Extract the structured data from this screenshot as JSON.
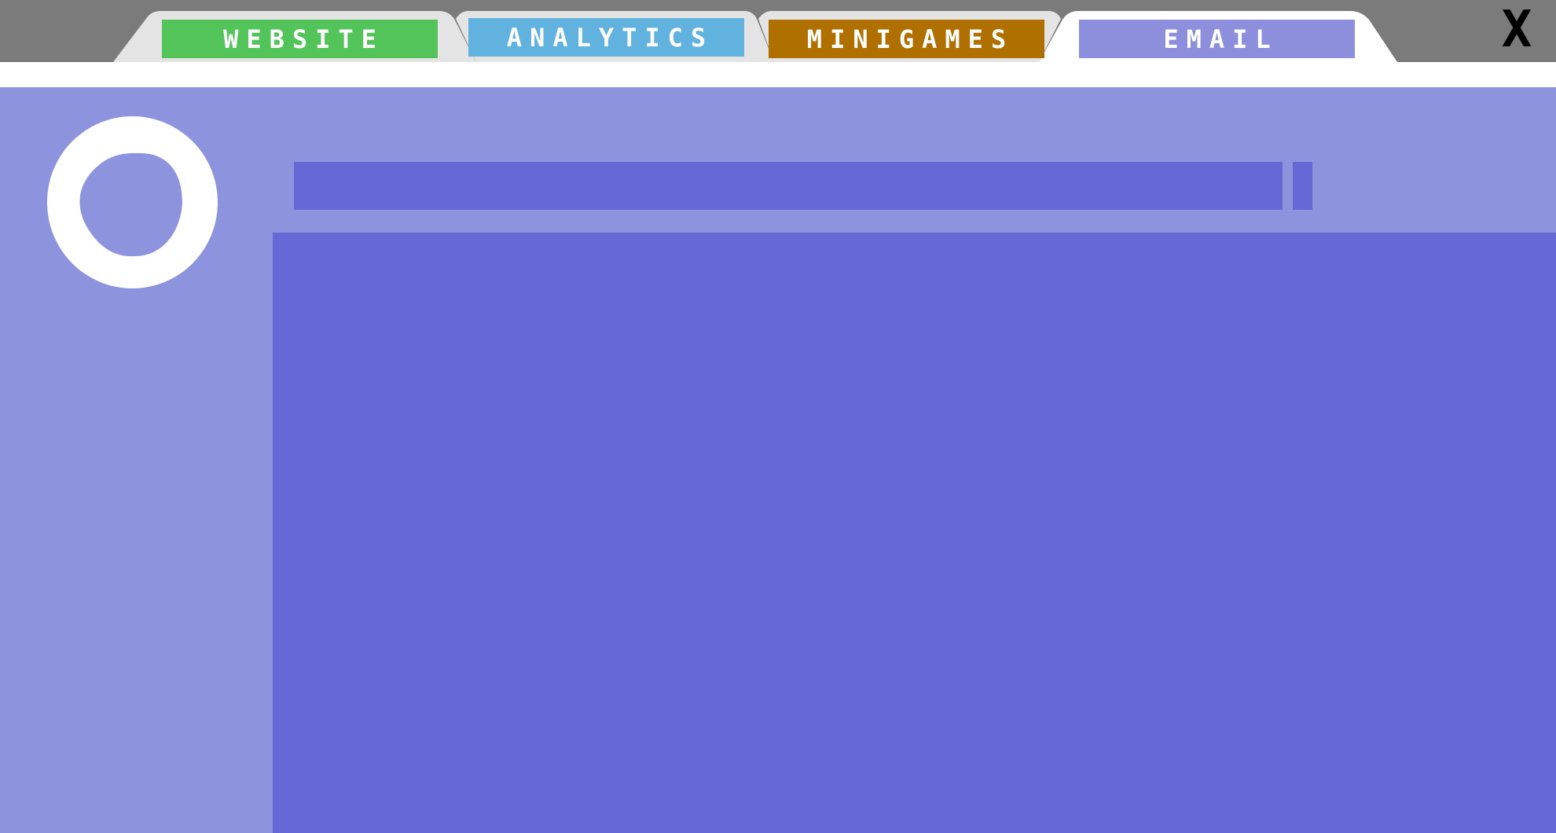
{
  "window": {
    "close_label": "X"
  },
  "tabs": [
    {
      "label": "WEBSITE",
      "color": "#52c45a",
      "active": false
    },
    {
      "label": "ANALYTICS",
      "color": "#62b2df",
      "active": false
    },
    {
      "label": "MINIGAMES",
      "color": "#b07000",
      "active": false
    },
    {
      "label": "EMAIL",
      "color": "#8e8fdc",
      "active": true
    }
  ],
  "colors": {
    "tabbar_background": "#7b7b7b",
    "inactive_folder": "#e4e4e4",
    "active_folder": "#ffffff",
    "email_panel_background": "#8e93dd",
    "email_field_color": "#6668d6",
    "avatar_color": "#ffffff"
  },
  "email": {
    "avatar_icon": "user-avatar-crescent-icon",
    "subject_value": "",
    "body_value": ""
  }
}
